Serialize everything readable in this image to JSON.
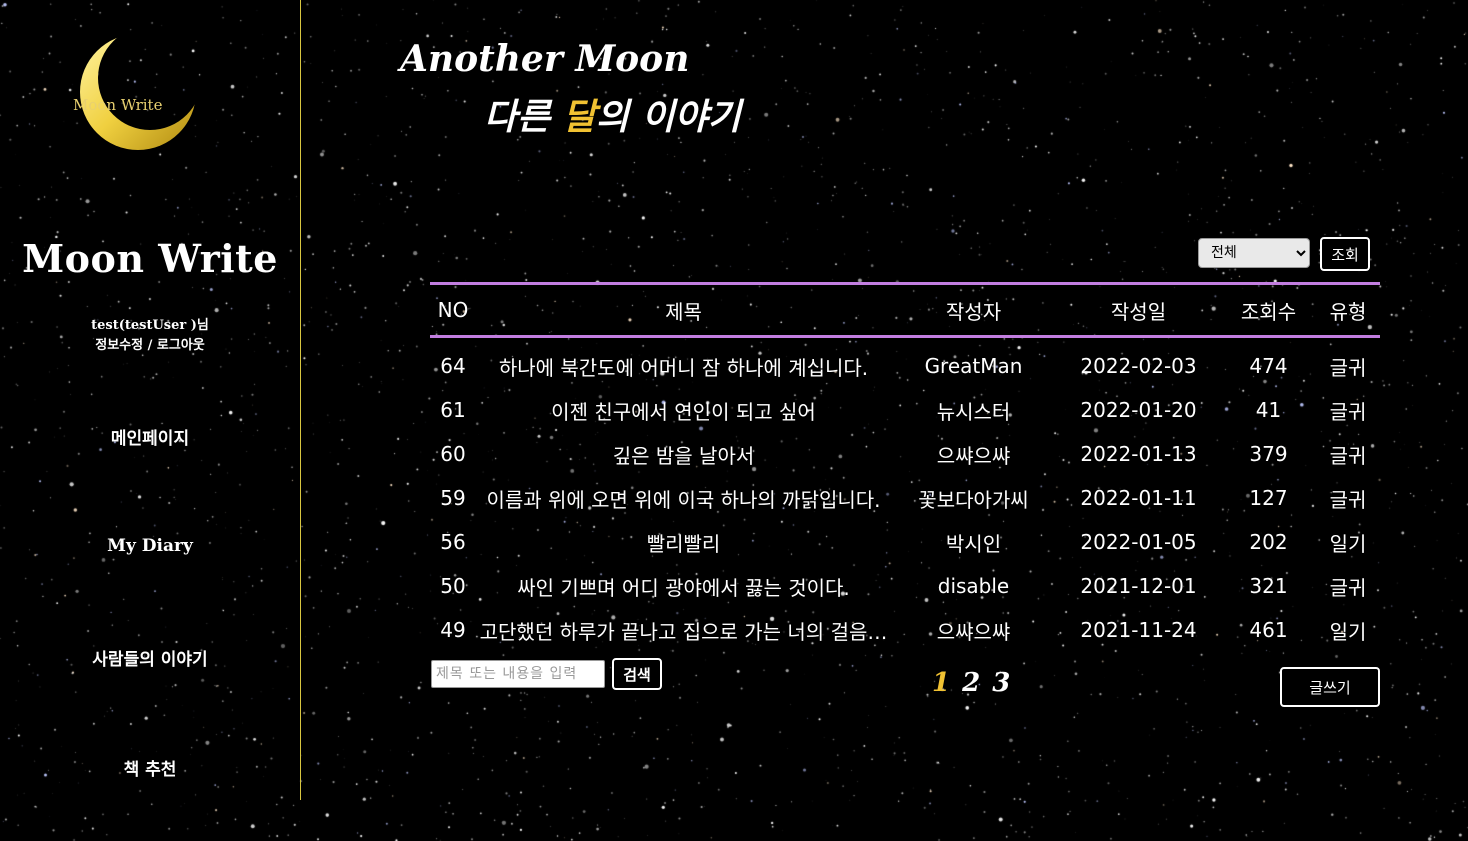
{
  "sidebar": {
    "logo_text": "Moon Write",
    "brand_title": "Moon Write",
    "user_greeting": "test(testUser )님",
    "edit_profile": "정보수정",
    "separator": " / ",
    "logout": "로그아웃",
    "nav": [
      {
        "label": "메인페이지"
      },
      {
        "label": "My Diary"
      },
      {
        "label": "사람들의 이야기"
      },
      {
        "label": "책 추천"
      }
    ]
  },
  "header": {
    "title_en": "Another Moon",
    "title_ko_before": "다른 ",
    "title_ko_accent": "달",
    "title_ko_after": "의 이야기"
  },
  "filter": {
    "selected": "전체",
    "lookup_label": "조회"
  },
  "table": {
    "columns": [
      "NO",
      "제목",
      "작성자",
      "작성일",
      "조회수",
      "유형"
    ],
    "rows": [
      {
        "no": "64",
        "title": "하나에 북간도에 어머니 잠 하나에 계십니다.",
        "author": "GreatMan",
        "date": "2022-02-03",
        "views": "474",
        "type": "글귀"
      },
      {
        "no": "61",
        "title": "이젠 친구에서 연인이 되고 싶어",
        "author": "뉴시스터",
        "date": "2022-01-20",
        "views": "41",
        "type": "글귀"
      },
      {
        "no": "60",
        "title": "깊은 밤을 날아서",
        "author": "으쌰으쌰",
        "date": "2022-01-13",
        "views": "379",
        "type": "글귀"
      },
      {
        "no": "59",
        "title": "이름과 위에 오면 위에 이국 하나의 까닭입니다.",
        "author": "꽃보다아가씨",
        "date": "2022-01-11",
        "views": "127",
        "type": "글귀"
      },
      {
        "no": "56",
        "title": "빨리빨리",
        "author": "박시인",
        "date": "2022-01-05",
        "views": "202",
        "type": "일기"
      },
      {
        "no": "50",
        "title": "싸인 기쁘며 어디 광야에서 끓는 것이다.",
        "author": "disable",
        "date": "2021-12-01",
        "views": "321",
        "type": "글귀"
      },
      {
        "no": "49",
        "title": "고단했던 하루가 끝나고 집으로 가는 너의 걸음…",
        "author": "으쌰으쌰",
        "date": "2021-11-24",
        "views": "461",
        "type": "일기"
      }
    ]
  },
  "search": {
    "placeholder": "제목 또는 내용을 입력",
    "button_label": "검색"
  },
  "pagination": {
    "pages": [
      "1",
      "2",
      "3"
    ],
    "current": "1"
  },
  "write_button_label": "글쓰기",
  "colors": {
    "accent": "#f1c232",
    "table_rule": "#c27ee0",
    "sidebar_divider": "#d8c640",
    "background": "#000000"
  }
}
